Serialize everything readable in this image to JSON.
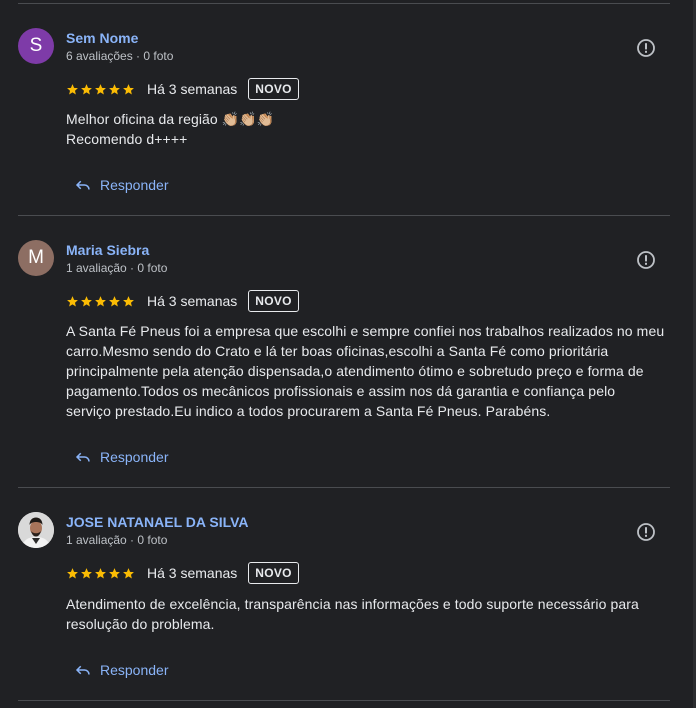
{
  "reviews": [
    {
      "author": "Sem Nome",
      "avatar_letter": "S",
      "meta": "6 avaliações · 0 foto",
      "rating": 5,
      "age": "Há 3 semanas",
      "badge": "NOVO",
      "text_lines": [
        "Melhor oficina da região 👏🏼👏🏼👏🏼",
        "Recomendo d++++"
      ],
      "reply_label": "Responder"
    },
    {
      "author": "Maria Siebra",
      "avatar_letter": "M",
      "meta": "1 avaliação · 0 foto",
      "rating": 5,
      "age": "Há 3 semanas",
      "badge": "NOVO",
      "text_lines": [
        "A Santa Fé Pneus foi a empresa que escolhi e sempre confiei nos trabalhos realizados no meu",
        "carro.Mesmo sendo do Crato e lá ter boas oficinas,escolhi a Santa Fé como prioritária",
        "principalmente pela atenção dispensada,o atendimento ótimo e sobretudo preço e forma de",
        "pagamento.Todos os mecânicos profissionais e assim nos dá garantia e confiança pelo",
        "serviço prestado.Eu indico a todos procurarem a Santa Fé Pneus. Parabéns."
      ],
      "reply_label": "Responder"
    },
    {
      "author": "JOSE NATANAEL DA SILVA",
      "avatar_letter": "",
      "meta": "1 avaliação · 0 foto",
      "rating": 5,
      "age": "Há 3 semanas",
      "badge": "NOVO",
      "text_lines": [
        "Atendimento de excelência, transparência nas informações e todo suporte necessário para",
        "resolução do problema."
      ],
      "reply_label": "Responder"
    }
  ],
  "colors": {
    "background": "#202124",
    "link": "#8ab4f8",
    "star": "#fbbc04",
    "divider": "#4a4c50"
  },
  "icons": {
    "flag": "report-flag-icon",
    "reply": "reply-arrow-icon",
    "star": "star-icon"
  }
}
